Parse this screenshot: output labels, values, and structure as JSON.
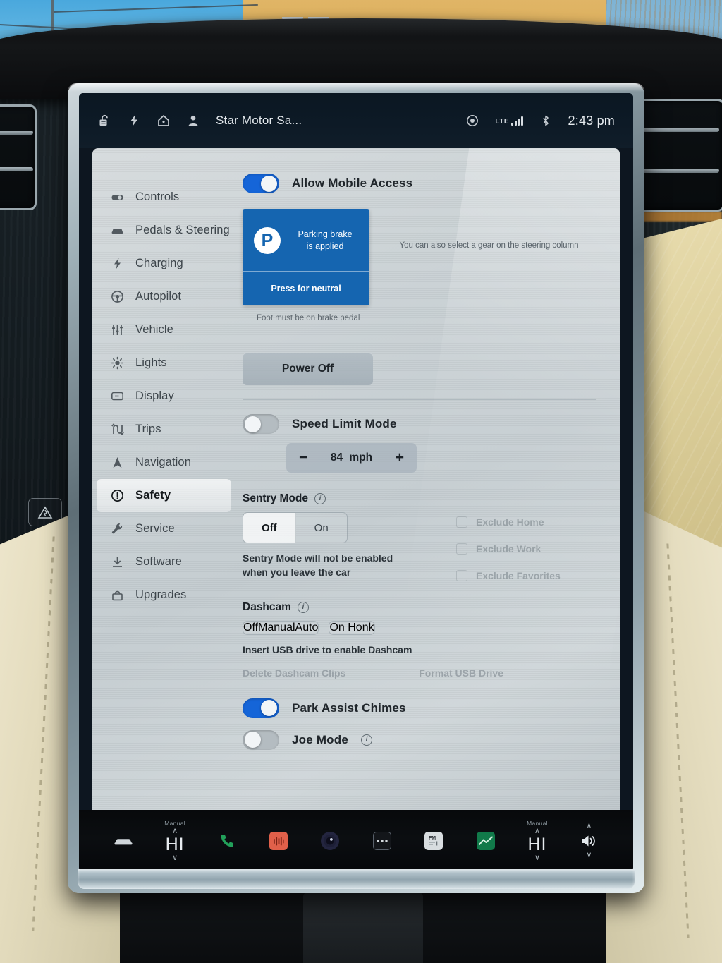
{
  "statusbar": {
    "icons": [
      "unlocked-padlock-icon",
      "lightning-bolt-icon",
      "home-icon",
      "profile-icon"
    ],
    "profile_name": "Star Motor Sa...",
    "recording_icon": "dashcam-record-icon",
    "network_label": "LTE",
    "bluetooth_icon": "bluetooth-icon",
    "time": "2:43 pm"
  },
  "sidebar": {
    "items": [
      {
        "label": "Controls",
        "icon": "toggle-icon",
        "active": false
      },
      {
        "label": "Pedals & Steering",
        "icon": "car-icon",
        "active": false
      },
      {
        "label": "Charging",
        "icon": "bolt-icon",
        "active": false
      },
      {
        "label": "Autopilot",
        "icon": "steering-wheel-icon",
        "active": false
      },
      {
        "label": "Vehicle",
        "icon": "sliders-icon",
        "active": false
      },
      {
        "label": "Lights",
        "icon": "sun-icon",
        "active": false
      },
      {
        "label": "Display",
        "icon": "display-icon",
        "active": false
      },
      {
        "label": "Trips",
        "icon": "route-icon",
        "active": false
      },
      {
        "label": "Navigation",
        "icon": "navigation-arrow-icon",
        "active": false
      },
      {
        "label": "Safety",
        "icon": "warning-circle-icon",
        "active": true
      },
      {
        "label": "Service",
        "icon": "wrench-icon",
        "active": false
      },
      {
        "label": "Software",
        "icon": "download-icon",
        "active": false
      },
      {
        "label": "Upgrades",
        "icon": "gift-icon",
        "active": false
      }
    ]
  },
  "content": {
    "mobile_access": {
      "label": "Allow Mobile Access",
      "state": "on"
    },
    "gear_card": {
      "badge": "P",
      "status_line1": "Parking brake",
      "status_line2": "is applied",
      "action": "Press for neutral",
      "side_note": "You can also select a gear on the steering column",
      "foot_note": "Foot must be on brake pedal",
      "accent": "#1565b0"
    },
    "power_off": {
      "label": "Power Off"
    },
    "speed_limit": {
      "label": "Speed Limit Mode",
      "state": "off",
      "minus": "−",
      "value": "84",
      "unit": "mph",
      "plus": "+"
    },
    "sentry_mode": {
      "title": "Sentry Mode",
      "info_icon": "info-icon",
      "options": [
        "Off",
        "On"
      ],
      "selected": "Off",
      "hint": "Sentry Mode will not be enabled when you leave the car",
      "exclusions": [
        "Exclude Home",
        "Exclude Work",
        "Exclude Favorites"
      ]
    },
    "dashcam": {
      "title": "Dashcam",
      "info_icon": "info-icon",
      "options": [
        "Off",
        "Manual",
        "Auto",
        "On Honk"
      ],
      "selected": "Manual",
      "hint": "Insert USB drive to enable Dashcam",
      "actions": [
        "Delete Dashcam Clips",
        "Format USB Drive"
      ]
    },
    "park_assist": {
      "label": "Park Assist Chimes",
      "state": "on"
    },
    "joe_mode": {
      "label": "Joe Mode",
      "state": "off",
      "info_icon": "info-icon"
    }
  },
  "dock": {
    "car_icon": "car-icon",
    "left_climate": {
      "mini": "Manual",
      "up": "∧",
      "value": "HI",
      "down": "∨"
    },
    "right_climate": {
      "mini": "Manual",
      "up": "∧",
      "value": "HI",
      "down": "∨"
    },
    "apps": [
      {
        "name": "phone-icon",
        "color": "#22a05a"
      },
      {
        "name": "media-equalizer-icon",
        "color": "#e0604a"
      },
      {
        "name": "camera-icon",
        "color": "#2a2d4a"
      },
      {
        "name": "more-dots-icon",
        "color": "#1a1d20"
      },
      {
        "name": "fm-radio-icon",
        "color": "#d8dde0"
      },
      {
        "name": "energy-chart-icon",
        "color": "#117a4a"
      }
    ],
    "volume": {
      "icon": "speaker-icon",
      "up": "∧",
      "down": "∨"
    }
  },
  "colors": {
    "accent_blue": "#1565d8",
    "card_blue": "#1565b0",
    "screen_bg": "#c8d0d4",
    "statusbar_bg": "#0d1a26"
  }
}
